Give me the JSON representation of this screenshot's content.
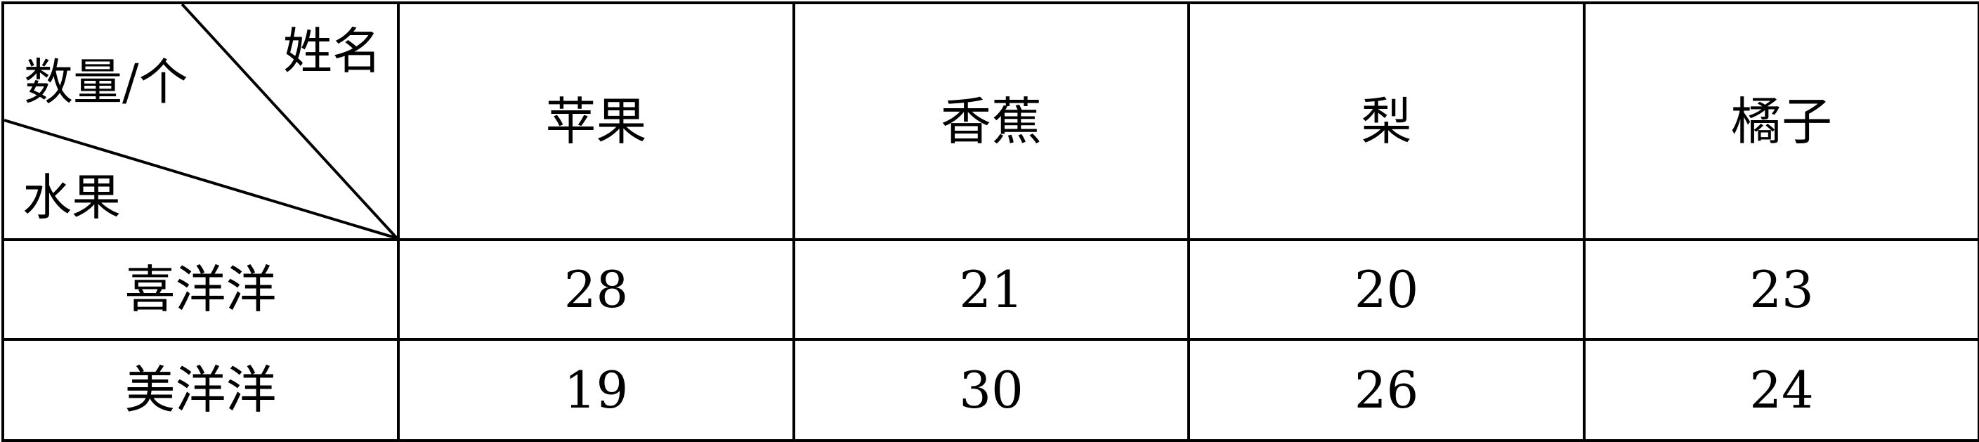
{
  "corner": {
    "top_right": "姓名",
    "middle": "数量/个",
    "bottom_left": "水果"
  },
  "columns": [
    "苹果",
    "香蕉",
    "梨",
    "橘子"
  ],
  "rows": [
    {
      "name": "喜洋洋",
      "values": [
        "28",
        "21",
        "20",
        "23"
      ]
    },
    {
      "name": "美洋洋",
      "values": [
        "19",
        "30",
        "26",
        "24"
      ]
    }
  ]
}
